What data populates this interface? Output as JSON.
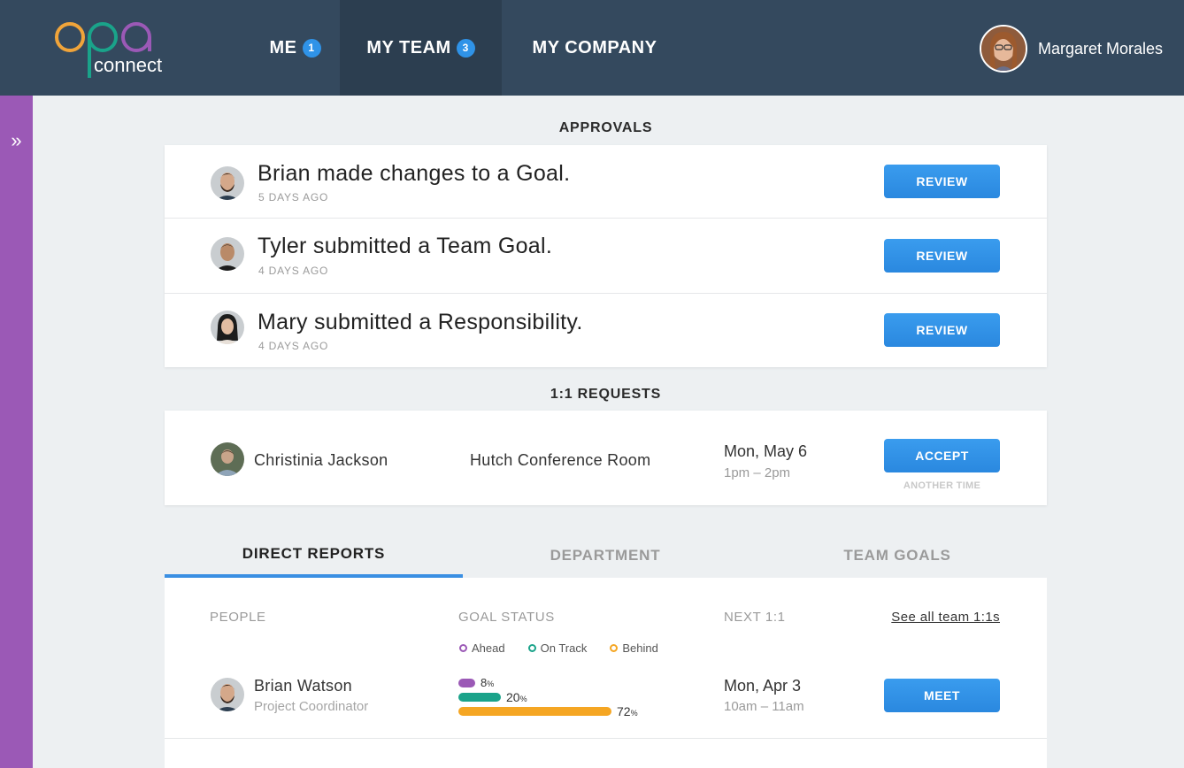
{
  "app": {
    "logo_top": "opa",
    "logo_bottom": "connect"
  },
  "nav": {
    "items": [
      {
        "label": "ME",
        "badge": "1"
      },
      {
        "label": "MY TEAM",
        "badge": "3"
      },
      {
        "label": "MY COMPANY"
      }
    ],
    "active": "MY TEAM"
  },
  "user": {
    "name": "Margaret Morales"
  },
  "sidebar": {
    "toggle_glyph": "»"
  },
  "approvals": {
    "title": "APPROVALS",
    "rows": [
      {
        "text": "Brian made changes to a Goal.",
        "time": "5 DAYS AGO",
        "action": "REVIEW"
      },
      {
        "text": "Tyler submitted a Team Goal.",
        "time": "4 DAYS AGO",
        "action": "REVIEW"
      },
      {
        "text": "Mary submitted a Responsibility.",
        "time": "4 DAYS AGO",
        "action": "REVIEW"
      }
    ]
  },
  "requests": {
    "title": "1:1 REQUESTS",
    "row": {
      "name": "Christinia Jackson",
      "location": "Hutch Conference Room",
      "date": "Mon, May 6",
      "time": "1pm – 2pm",
      "action": "ACCEPT",
      "alt_action": "ANOTHER TIME"
    }
  },
  "tabs": [
    {
      "label": "DIRECT REPORTS",
      "active": true
    },
    {
      "label": "DEPARTMENT",
      "active": false
    },
    {
      "label": "TEAM GOALS",
      "active": false
    }
  ],
  "reports": {
    "headers": {
      "people": "PEOPLE",
      "goal_status": "GOAL STATUS",
      "next": "NEXT 1:1",
      "see_all": "See all team 1:1s"
    },
    "legend": [
      {
        "label": "Ahead",
        "color": "#9b59b6"
      },
      {
        "label": "On Track",
        "color": "#1aa38a"
      },
      {
        "label": "Behind",
        "color": "#f5a623"
      }
    ],
    "rows": [
      {
        "name": "Brian Watson",
        "role": "Project Coordinator",
        "goals": [
          {
            "status": "Ahead",
            "value": "8",
            "unit": "%",
            "color": "#9b59b6",
            "fraction": 0.08
          },
          {
            "status": "On Track",
            "value": "20",
            "unit": "%",
            "color": "#1aa38a",
            "fraction": 0.2
          },
          {
            "status": "Behind",
            "value": "72",
            "unit": "%",
            "color": "#f5a623",
            "fraction": 0.72
          }
        ],
        "next_date": "Mon, Apr 3",
        "next_time": "10am – 11am",
        "action": "MEET"
      }
    ]
  }
}
